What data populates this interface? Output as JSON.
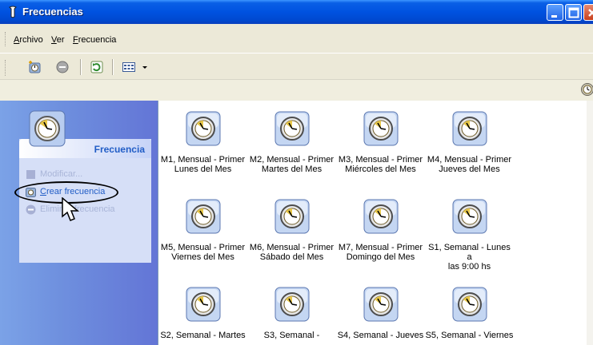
{
  "window": {
    "title": "Frecuencias"
  },
  "menubar": {
    "items": [
      {
        "label": "Archivo",
        "accel": "A",
        "rest": "rchivo"
      },
      {
        "label": "Ver",
        "accel": "V",
        "rest": "er"
      },
      {
        "label": "Frecuencia",
        "accel": "F",
        "rest": "recuencia"
      }
    ]
  },
  "toolbar": {
    "buttons": [
      "create-icon",
      "delete-icon",
      "refresh-icon",
      "view-icon",
      "view-dropdown-icon"
    ]
  },
  "sidebar": {
    "title": "Frecuencia",
    "tasks": [
      {
        "label": "Modificar...",
        "enabled": false
      },
      {
        "label": "Crear frecuencia",
        "accel": "C",
        "rest": "rear frecuencia",
        "enabled": true
      },
      {
        "label": "Eliminar frecuencia",
        "enabled": false
      }
    ]
  },
  "items": [
    {
      "line1": "M1, Mensual - Primer",
      "line2": "Lunes del Mes"
    },
    {
      "line1": "M2, Mensual - Primer",
      "line2": "Martes del Mes"
    },
    {
      "line1": "M3, Mensual - Primer",
      "line2": "Miércoles del Mes"
    },
    {
      "line1": "M4, Mensual - Primer",
      "line2": "Jueves del Mes"
    },
    {
      "line1": "M5, Mensual - Primer",
      "line2": "Viernes del Mes"
    },
    {
      "line1": "M6, Mensual - Primer",
      "line2": "Sábado del Mes"
    },
    {
      "line1": "M7, Mensual - Primer",
      "line2": "Domingo del Mes"
    },
    {
      "line1": "S1, Semanal - Lunes a",
      "line2": "las 9:00 hs"
    },
    {
      "line1": "S2, Semanal - Martes",
      "line2": ""
    },
    {
      "line1": "S3, Semanal -",
      "line2": ""
    },
    {
      "line1": "S4, Semanal - Jueves",
      "line2": ""
    },
    {
      "line1": "S5, Semanal - Viernes",
      "line2": ""
    }
  ],
  "colors": {
    "titlebar": "#0052e0",
    "sidebar": "#6e8fde",
    "link": "#215dc6"
  }
}
